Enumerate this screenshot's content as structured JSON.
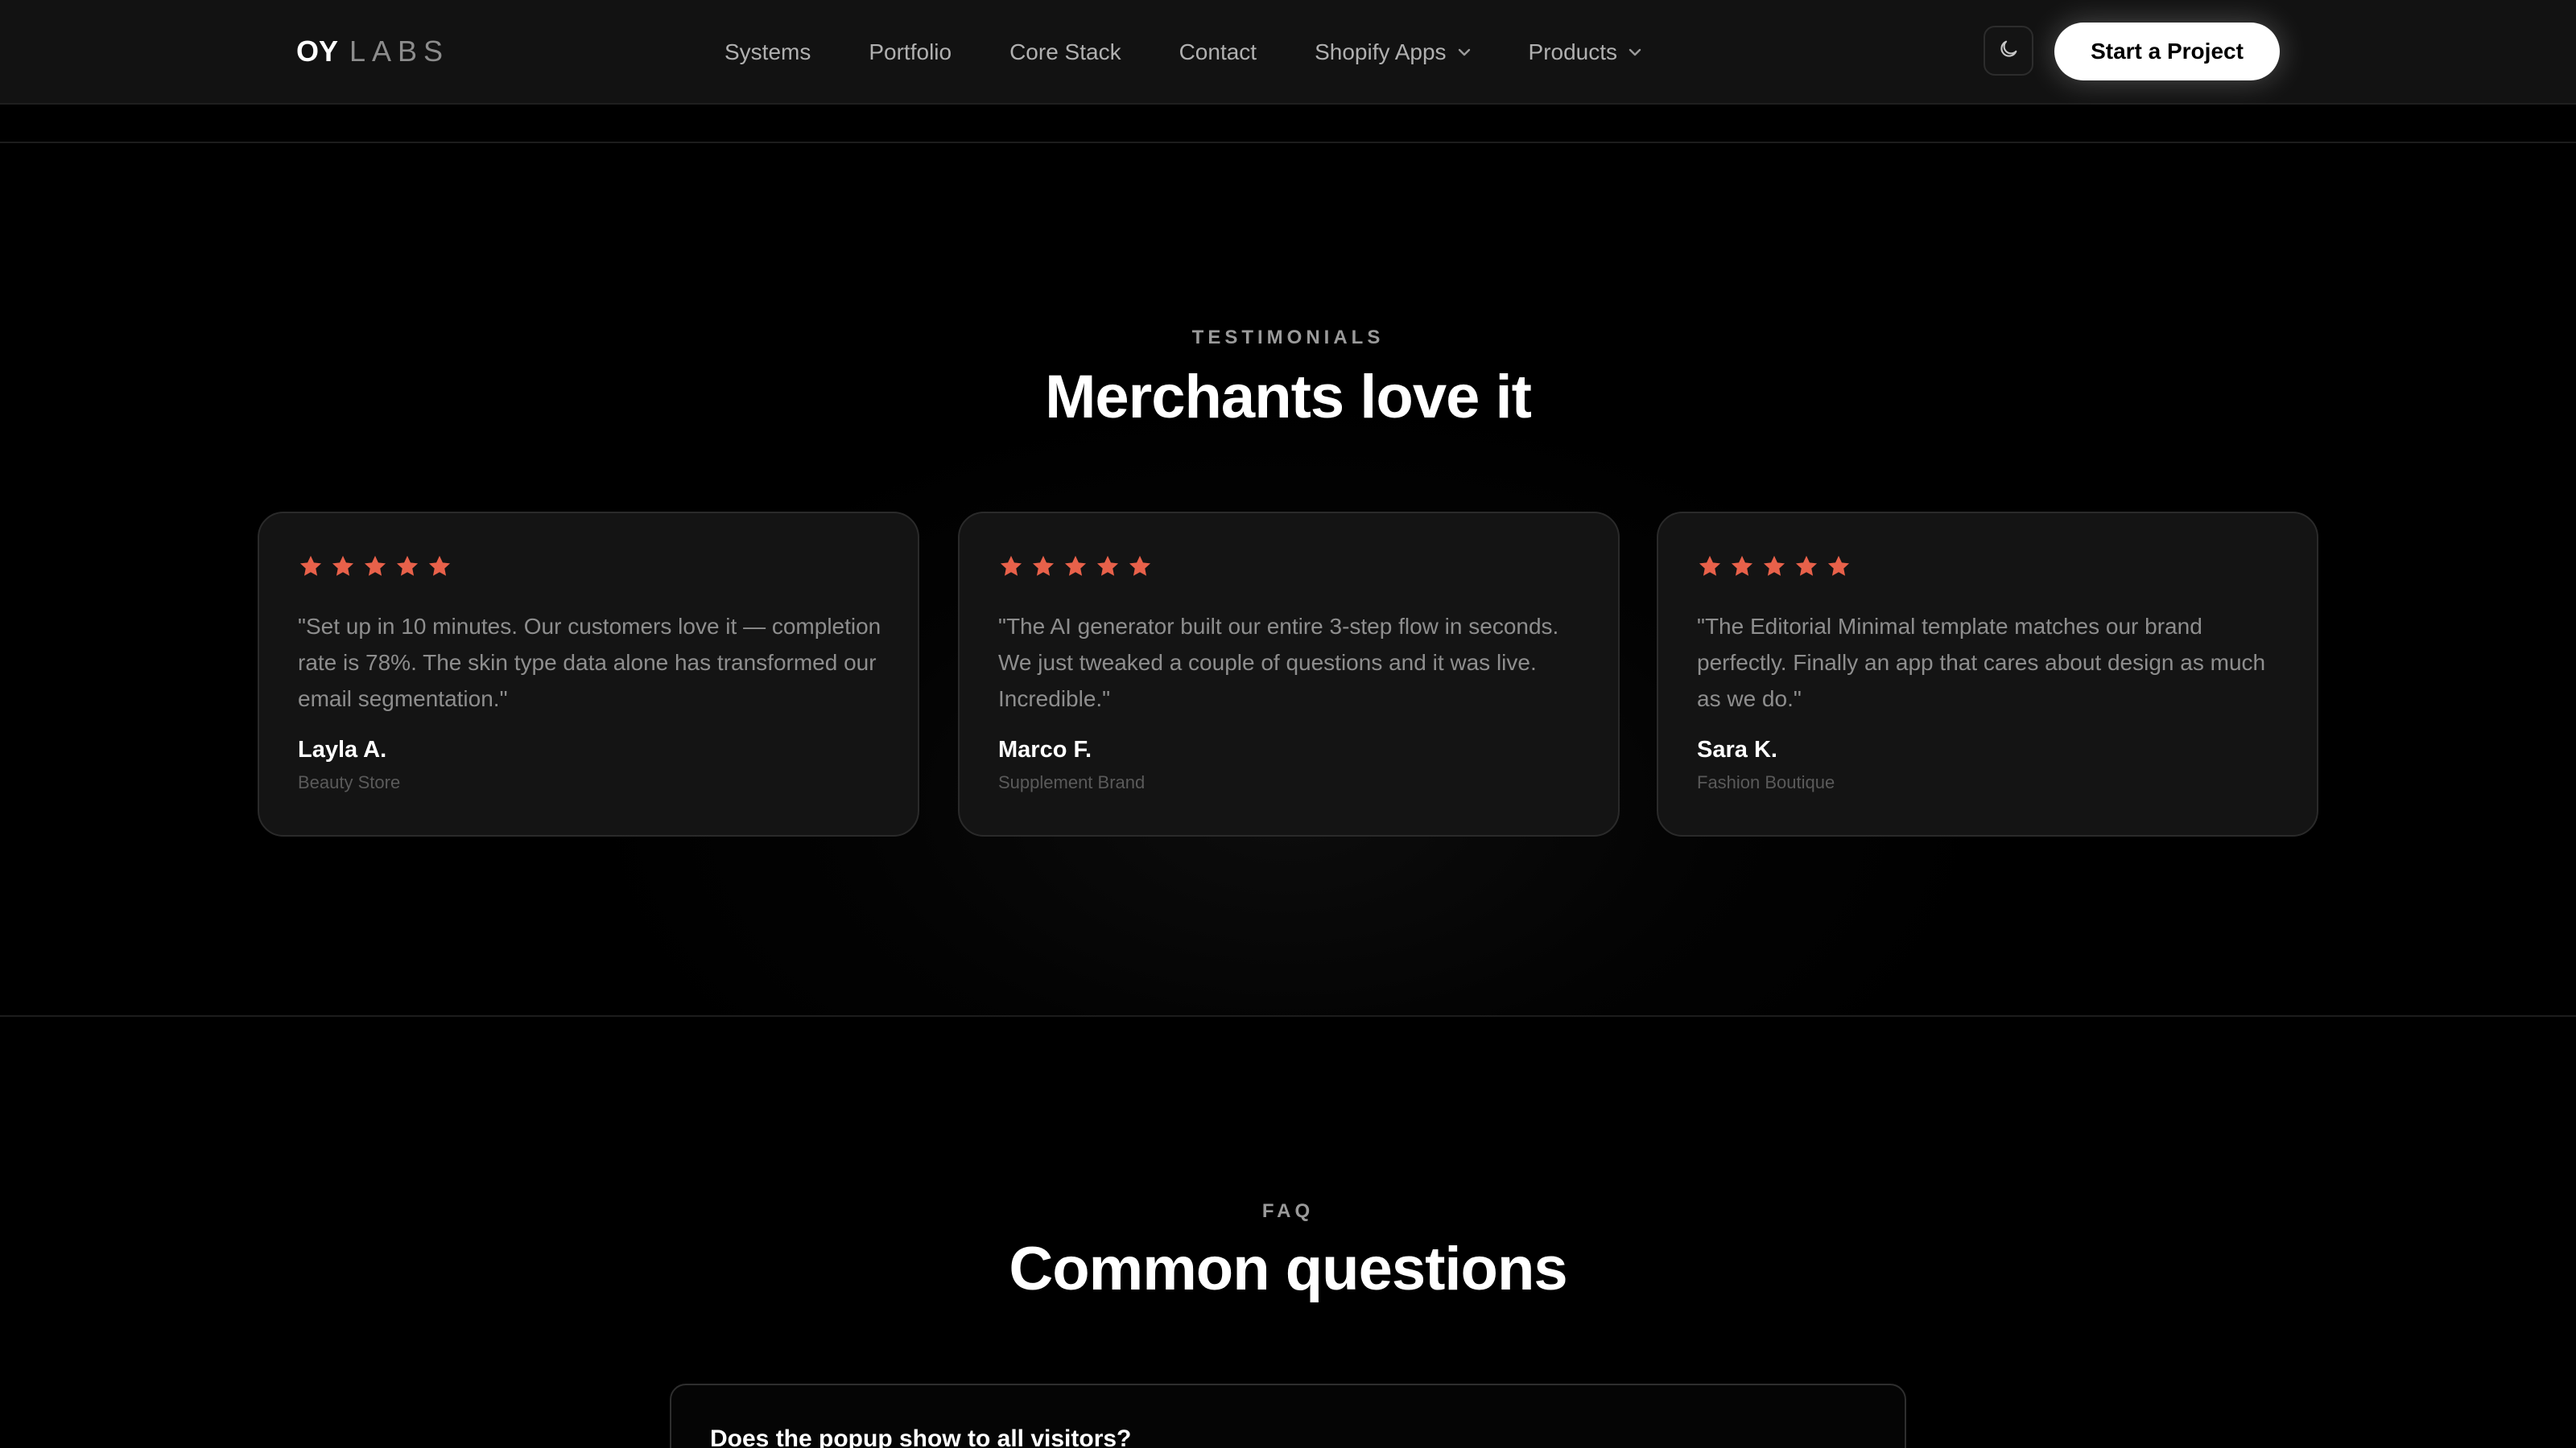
{
  "navbar": {
    "logo_primary": "OY",
    "logo_secondary": "LABS",
    "links": [
      {
        "label": "Systems"
      },
      {
        "label": "Portfolio"
      },
      {
        "label": "Core Stack"
      },
      {
        "label": "Contact"
      },
      {
        "label": "Shopify Apps",
        "icon": "chevron-down-icon"
      },
      {
        "label": "Products",
        "icon": "chevron-down-icon"
      }
    ],
    "theme_toggle_icon": "moon-icon",
    "cta_label": "Start a Project"
  },
  "testimonials": {
    "eyebrow": "TESTIMONIALS",
    "title": "Merchants love it",
    "star_color": "#e8614a",
    "items": [
      {
        "rating": 5,
        "quote": "\"Set up in 10 minutes. Our customers love it — completion rate is 78%. The skin type data alone has transformed our email segmentation.\"",
        "author": "Layla A.",
        "role": "Beauty Store"
      },
      {
        "rating": 5,
        "quote": "\"The AI generator built our entire 3-step flow in seconds. We just tweaked a couple of questions and it was live. Incredible.\"",
        "author": "Marco F.",
        "role": "Supplement Brand"
      },
      {
        "rating": 5,
        "quote": "\"The Editorial Minimal template matches our brand perfectly. Finally an app that cares about design as much as we do.\"",
        "author": "Sara K.",
        "role": "Fashion Boutique"
      }
    ]
  },
  "faq": {
    "eyebrow": "FAQ",
    "title": "Common questions",
    "items": [
      {
        "question": "Does the popup show to all visitors?"
      }
    ]
  }
}
